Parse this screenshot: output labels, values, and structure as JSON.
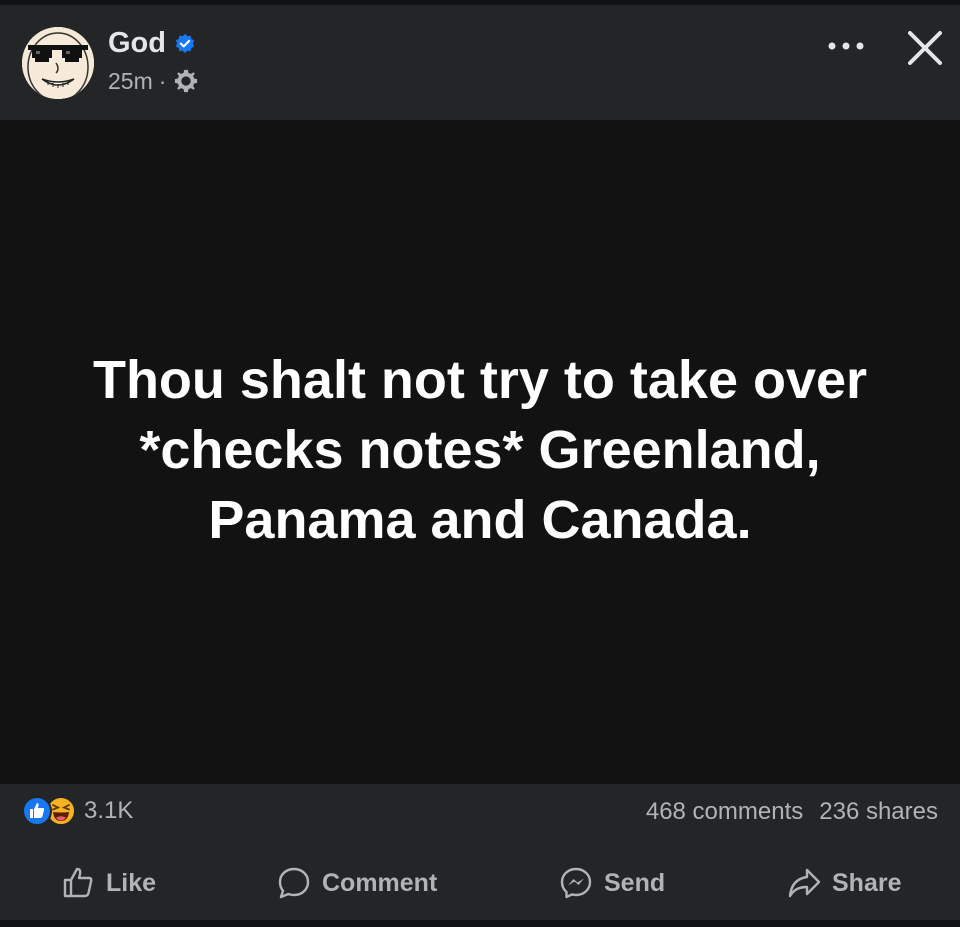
{
  "post": {
    "author": "God",
    "verified": true,
    "time": "25m",
    "separator": "·",
    "text": "Thou shalt not try to take over *checks notes* Greenland, Panama and Canada."
  },
  "reactions": {
    "types": [
      "like",
      "haha"
    ],
    "count": "3.1K"
  },
  "stats": {
    "comments": "468 comments",
    "shares": "236 shares"
  },
  "actions": {
    "like": "Like",
    "comment": "Comment",
    "send": "Send",
    "share": "Share"
  },
  "colors": {
    "verified_blue": "#1877f2",
    "header_bg": "#242526",
    "post_bg": "#121213",
    "secondary_text": "#b0b3b8"
  }
}
